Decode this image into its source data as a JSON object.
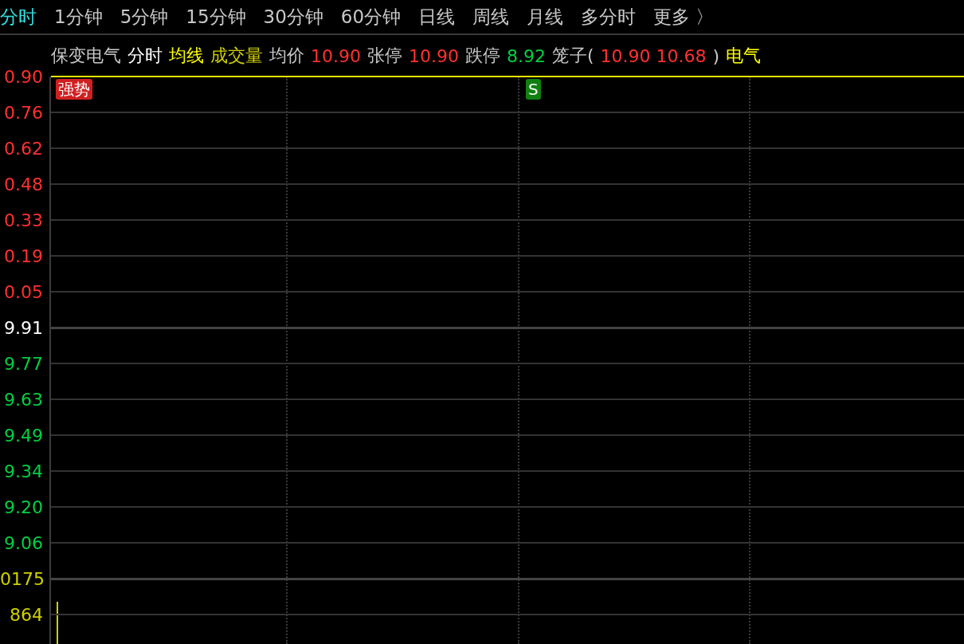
{
  "period_tabs": [
    {
      "label": "分时",
      "selected": true
    },
    {
      "label": "1分钟",
      "selected": false
    },
    {
      "label": "5分钟",
      "selected": false
    },
    {
      "label": "15分钟",
      "selected": false
    },
    {
      "label": "30分钟",
      "selected": false
    },
    {
      "label": "60分钟",
      "selected": false
    },
    {
      "label": "日线",
      "selected": false
    },
    {
      "label": "周线",
      "selected": false
    },
    {
      "label": "月线",
      "selected": false
    },
    {
      "label": "多分时",
      "selected": false
    },
    {
      "label": "更多 〉",
      "selected": false
    }
  ],
  "info_bar": [
    {
      "text": "保变电气",
      "color": "#c8c8c8"
    },
    {
      "text": "分时",
      "color": "#ffffff"
    },
    {
      "text": "均线",
      "color": "#ffff00"
    },
    {
      "text": "成交量",
      "color": "#d0d000"
    },
    {
      "text": "均价",
      "color": "#c8c8c8"
    },
    {
      "text": "10.90",
      "color": "#ff3030"
    },
    {
      "text": "张停",
      "color": "#c8c8c8"
    },
    {
      "text": "10.90",
      "color": "#ff3030"
    },
    {
      "text": "跌停",
      "color": "#c8c8c8"
    },
    {
      "text": "8.92",
      "color": "#00d040"
    },
    {
      "text": "笼子(",
      "color": "#c8c8c8"
    },
    {
      "text": "10.90 10.68",
      "color": "#ff3030"
    },
    {
      "text": ")",
      "color": "#c8c8c8"
    },
    {
      "text": "电气",
      "color": "#ffff00"
    }
  ],
  "badges": [
    {
      "text": "强势",
      "color": "#d02020"
    },
    {
      "text": "S",
      "color": "#108010"
    }
  ],
  "price_axis": [
    {
      "label": "0.90",
      "color": "#ff3030"
    },
    {
      "label": "0.76",
      "color": "#ff3030"
    },
    {
      "label": "0.62",
      "color": "#ff3030"
    },
    {
      "label": "0.48",
      "color": "#ff3030"
    },
    {
      "label": "0.33",
      "color": "#ff3030"
    },
    {
      "label": "0.19",
      "color": "#ff3030"
    },
    {
      "label": "0.05",
      "color": "#ff3030"
    },
    {
      "label": "9.91",
      "color": "#ffffff"
    },
    {
      "label": "9.77",
      "color": "#00d040"
    },
    {
      "label": "9.63",
      "color": "#00d040"
    },
    {
      "label": "9.49",
      "color": "#00d040"
    },
    {
      "label": "9.34",
      "color": "#00d040"
    },
    {
      "label": "9.20",
      "color": "#00d040"
    },
    {
      "label": "9.06",
      "color": "#00d040"
    },
    {
      "label": "0175",
      "color": "#d0d000"
    },
    {
      "label": "864",
      "color": "#d0d000"
    }
  ]
}
